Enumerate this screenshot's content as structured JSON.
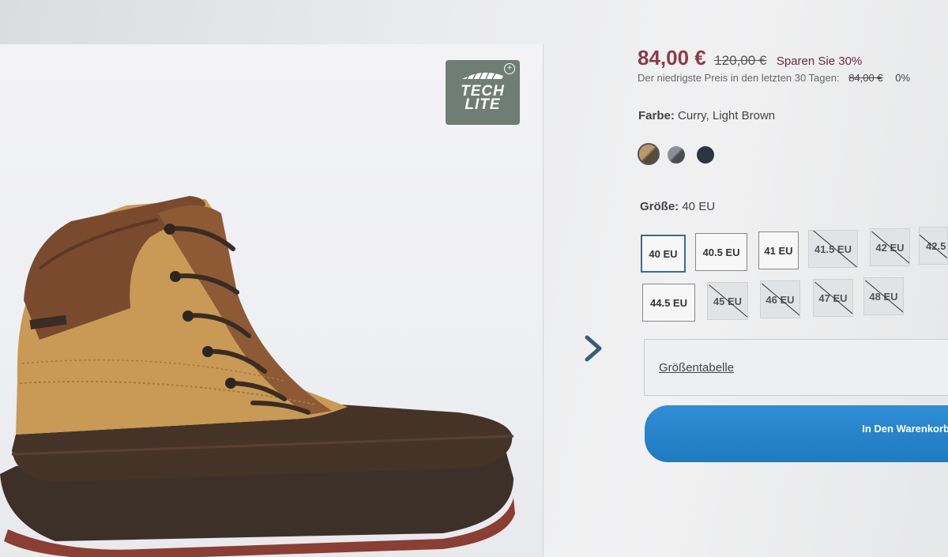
{
  "badge": {
    "text_line1": "TECH",
    "text_line2": "LITE"
  },
  "price": {
    "current": "84,00 €",
    "original": "120,00 €",
    "savings": "Sparen Sie 30%",
    "lowest_label": "Der niedrigste Preis in den letzten 30 Tagen:",
    "lowest_value": "84,00 €",
    "lowest_percent": "0%"
  },
  "color": {
    "label": "Farbe:",
    "value": "Curry, Light Brown",
    "swatches": [
      "curry-light-brown",
      "grey",
      "navy"
    ],
    "selected": "curry-light-brown"
  },
  "size": {
    "label": "Größe:",
    "value": "40 EU",
    "options": [
      {
        "label": "40 EU",
        "state": "selected"
      },
      {
        "label": "40.5 EU",
        "state": "available"
      },
      {
        "label": "41 EU",
        "state": "available"
      },
      {
        "label": "41.5 EU",
        "state": "unavailable"
      },
      {
        "label": "42 EU",
        "state": "unavailable"
      },
      {
        "label": "42.5",
        "state": "unavailable"
      },
      {
        "label": "44.5 EU",
        "state": "available"
      },
      {
        "label": "45 EU",
        "state": "unavailable"
      },
      {
        "label": "46 EU",
        "state": "unavailable"
      },
      {
        "label": "47 EU",
        "state": "unavailable"
      },
      {
        "label": "48 EU",
        "state": "unavailable"
      }
    ]
  },
  "size_chart_label": "Größentabelle",
  "cart_button_label": "In Den Warenkorb",
  "colors": {
    "price": "#8b3b4c",
    "cart_button": "#2388cc",
    "selected_size_border": "#3d6a8f"
  }
}
